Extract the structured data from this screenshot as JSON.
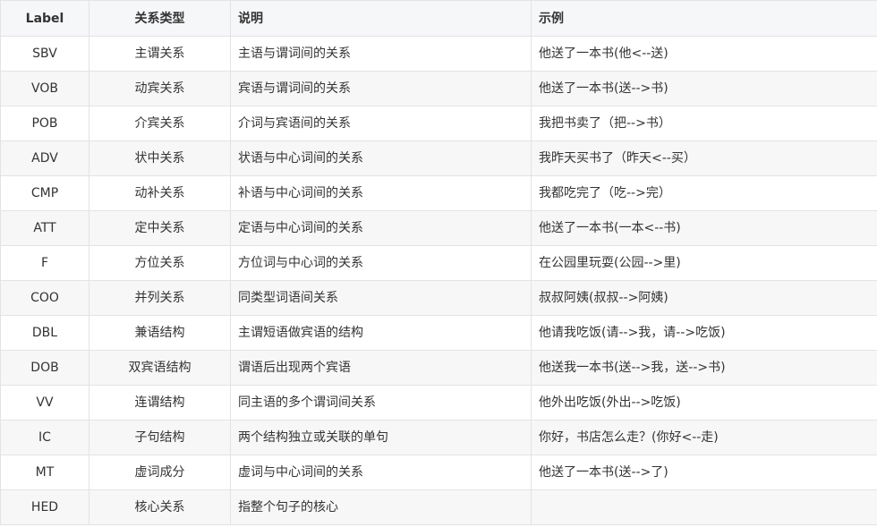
{
  "table": {
    "headers": {
      "label": "Label",
      "type": "关系类型",
      "desc": "说明",
      "example": "示例"
    },
    "rows": [
      {
        "label": "SBV",
        "type": "主谓关系",
        "desc": "主语与谓词间的关系",
        "example": "他送了一本书(他<--送)"
      },
      {
        "label": "VOB",
        "type": "动宾关系",
        "desc": "宾语与谓词间的关系",
        "example": "他送了一本书(送-->书)"
      },
      {
        "label": "POB",
        "type": "介宾关系",
        "desc": "介词与宾语间的关系",
        "example": "我把书卖了（把-->书）"
      },
      {
        "label": "ADV",
        "type": "状中关系",
        "desc": "状语与中心词间的关系",
        "example": "我昨天买书了（昨天<--买）"
      },
      {
        "label": "CMP",
        "type": "动补关系",
        "desc": "补语与中心词间的关系",
        "example": "我都吃完了（吃-->完）"
      },
      {
        "label": "ATT",
        "type": "定中关系",
        "desc": "定语与中心词间的关系",
        "example": "他送了一本书(一本<--书)"
      },
      {
        "label": "F",
        "type": "方位关系",
        "desc": "方位词与中心词的关系",
        "example": "在公园里玩耍(公园-->里)"
      },
      {
        "label": "COO",
        "type": "并列关系",
        "desc": "同类型词语间关系",
        "example": "叔叔阿姨(叔叔-->阿姨)"
      },
      {
        "label": "DBL",
        "type": "兼语结构",
        "desc": "主谓短语做宾语的结构",
        "example": "他请我吃饭(请-->我，请-->吃饭)"
      },
      {
        "label": "DOB",
        "type": "双宾语结构",
        "desc": "谓语后出现两个宾语",
        "example": "他送我一本书(送-->我，送-->书)"
      },
      {
        "label": "VV",
        "type": "连谓结构",
        "desc": "同主语的多个谓词间关系",
        "example": "他外出吃饭(外出-->吃饭)"
      },
      {
        "label": "IC",
        "type": "子句结构",
        "desc": "两个结构独立或关联的单句",
        "example": "你好，书店怎么走？(你好<--走)"
      },
      {
        "label": "MT",
        "type": "虚词成分",
        "desc": "虚词与中心词间的关系",
        "example": "他送了一本书(送-->了)"
      },
      {
        "label": "HED",
        "type": "核心关系",
        "desc": "指整个句子的核心",
        "example": ""
      }
    ]
  }
}
